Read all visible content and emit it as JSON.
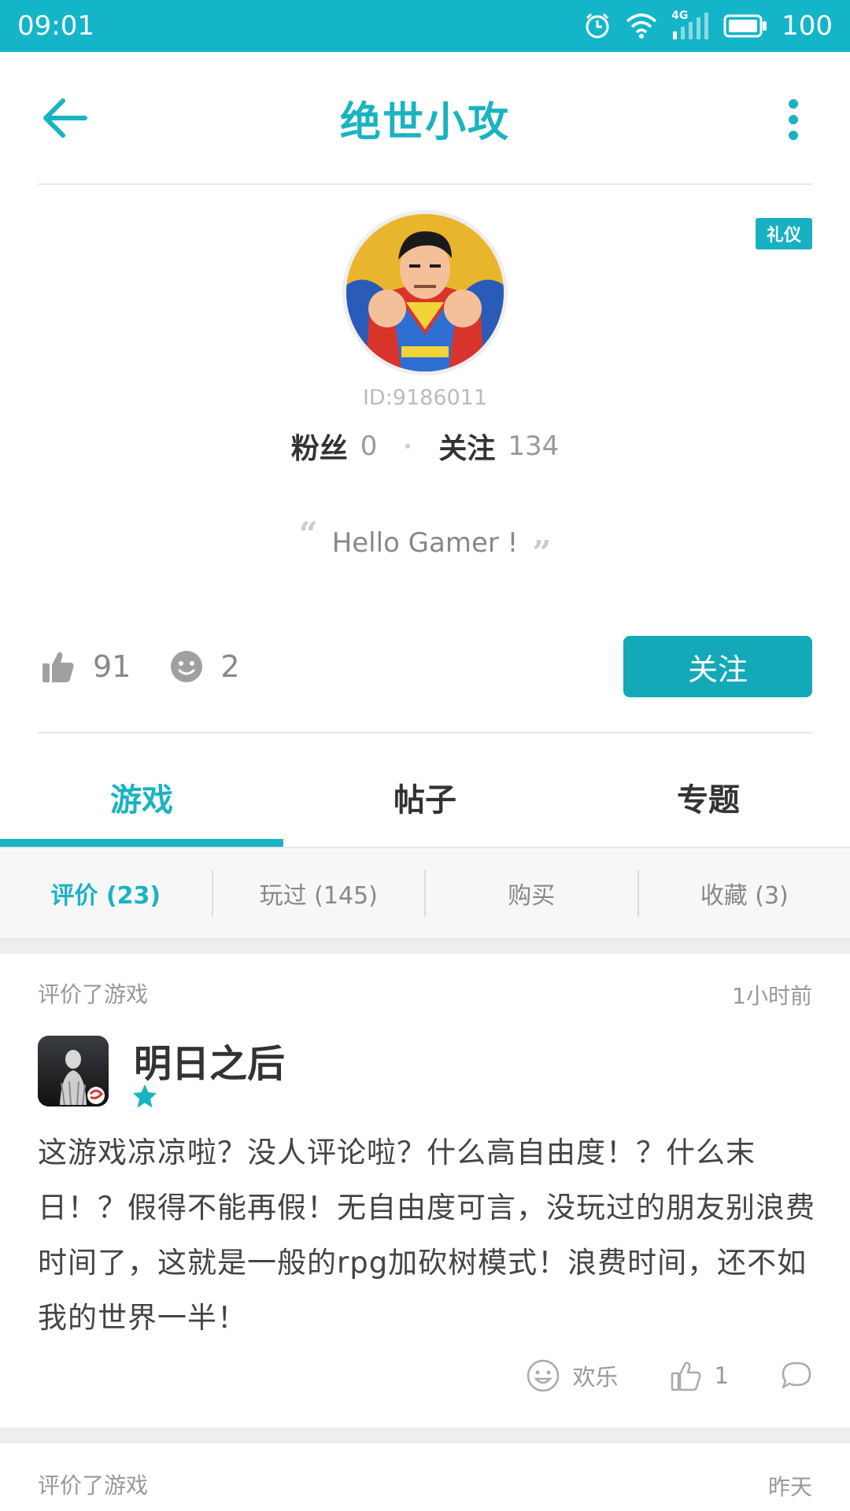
{
  "status_bar": {
    "time": "09:01",
    "network": "4G",
    "battery": "100"
  },
  "header": {
    "title": "绝世小攻"
  },
  "profile": {
    "badge": "礼仪",
    "user_id": "ID:9186011",
    "fans_label": "粉丝",
    "fans_count": "0",
    "following_label": "关注",
    "following_count": "134",
    "signature": "Hello Gamer !",
    "likes": "91",
    "emotes": "2",
    "follow_button": "关注"
  },
  "tabs": [
    "游戏",
    "帖子",
    "专题"
  ],
  "subtabs": [
    "评价 (23)",
    "玩过 (145)",
    "购买",
    "收藏 (3)"
  ],
  "reviews": [
    {
      "action": "评价了游戏",
      "time": "1小时前",
      "game": "明日之后",
      "text": "这游戏凉凉啦？没人评论啦？什么高自由度！？什么末日！？假得不能再假！无自由度可言，没玩过的朋友别浪费时间了，这就是一般的rpg加砍树模式！浪费时间，还不如我的世界一半！",
      "mood": "欢乐",
      "likes": "1"
    },
    {
      "action": "评价了游戏",
      "time": "昨天"
    }
  ],
  "colors": {
    "accent": "#14b5c8",
    "button": "#14a9b8"
  }
}
